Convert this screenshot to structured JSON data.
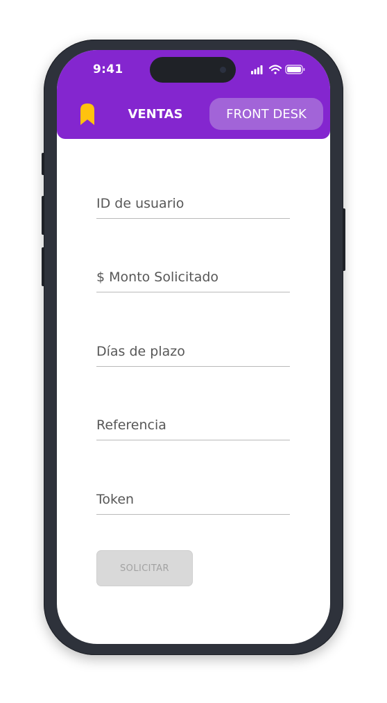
{
  "status_bar": {
    "time": "9:41",
    "icons": [
      "signal-icon",
      "wifi-icon",
      "battery-icon"
    ]
  },
  "header": {
    "logo": "brand-logo",
    "tabs": [
      {
        "label": "VENTAS",
        "active": false
      },
      {
        "label": "FRONT DESK",
        "active": true
      }
    ]
  },
  "form": {
    "fields": [
      {
        "placeholder": "ID de usuario",
        "value": ""
      },
      {
        "placeholder": "$ Monto Solicitado",
        "value": ""
      },
      {
        "placeholder": "Días de plazo",
        "value": ""
      },
      {
        "placeholder": "Referencia",
        "value": ""
      },
      {
        "placeholder": "Token",
        "value": ""
      }
    ],
    "submit_label": "SOLICITAR",
    "submit_enabled": false
  },
  "colors": {
    "brand_purple": "#8426cf",
    "active_tab_bg": "#a264d8",
    "logo_yellow": "#ffc20e",
    "disabled_button": "#d9d9d9",
    "frame": "#2e323b"
  }
}
